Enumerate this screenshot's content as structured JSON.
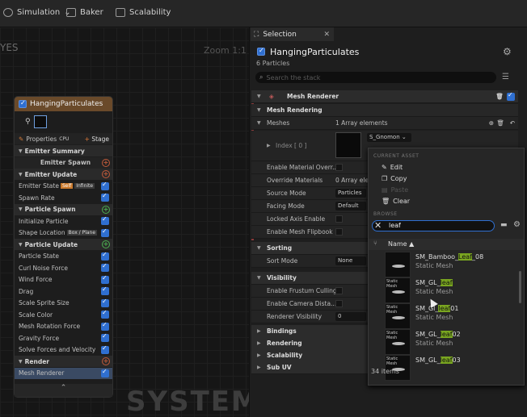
{
  "toolbar": {
    "simulation": "Simulation",
    "baker": "Baker",
    "scalability": "Scalability"
  },
  "graph": {
    "tab_fragment": "YES",
    "zoom": "Zoom 1:1",
    "watermark": "SYSTEM"
  },
  "node": {
    "title": "HangingParticulates",
    "properties": "Properties",
    "stage": "Stage",
    "rows": [
      {
        "label": "Emitter Summary",
        "type": "sec"
      },
      {
        "label": "Emitter Spawn",
        "type": "sub",
        "plus": "red"
      },
      {
        "label": "Emitter Update",
        "type": "sec",
        "plus": "red"
      },
      {
        "label": "Emitter State",
        "badges": [
          "Self",
          "Infinite"
        ],
        "check": true
      },
      {
        "label": "Spawn Rate",
        "check": true
      },
      {
        "label": "Particle Spawn",
        "type": "sec",
        "plus": "green"
      },
      {
        "label": "Initialize Particle",
        "check": true
      },
      {
        "label": "Shape Location",
        "badges2": [
          "Box / Plane"
        ],
        "check": true
      },
      {
        "label": "Particle Update",
        "type": "sec",
        "plus": "green"
      },
      {
        "label": "Particle State",
        "check": true
      },
      {
        "label": "Curl Noise Force",
        "check": true
      },
      {
        "label": "Wind Force",
        "check": true
      },
      {
        "label": "Drag",
        "check": true
      },
      {
        "label": "Scale Sprite Size",
        "check": true
      },
      {
        "label": "Scale Color",
        "check": true
      },
      {
        "label": "Mesh Rotation Force",
        "check": true
      },
      {
        "label": "Gravity Force",
        "check": true
      },
      {
        "label": "Solve Forces and Velocity",
        "check": true
      },
      {
        "label": "Render",
        "type": "sec",
        "plus": "red"
      },
      {
        "label": "Mesh Renderer",
        "check": true,
        "selected": true
      }
    ]
  },
  "selection": {
    "tab": "Selection",
    "emitter": "HangingParticulates",
    "particles": "6 Particles",
    "search_placeholder": "Search the stack",
    "rows": {
      "mesh_renderer": "Mesh Renderer",
      "mesh_rendering": "Mesh Rendering",
      "meshes": "Meshes",
      "meshes_val": "1 Array elements",
      "index": "Index [ 0 ]",
      "mesh_dropdown": "S_Gnomon",
      "enable_mat": "Enable Material Overr...",
      "override_mat": "Override Materials",
      "override_val": "0 Array ele",
      "source_mode": "Source Mode",
      "source_val": "Particles",
      "facing_mode": "Facing Mode",
      "facing_val": "Default",
      "locked_axis": "Locked Axis Enable",
      "flipbook": "Enable Mesh Flipbook",
      "sorting": "Sorting",
      "sort_mode": "Sort Mode",
      "sort_val": "None",
      "visibility": "Visibility",
      "frustum": "Enable Frustum Culling",
      "camera_dist": "Enable Camera Dista...",
      "renderer_vis": "Renderer Visibility",
      "renderer_vis_val": "0",
      "bindings": "Bindings",
      "rendering": "Rendering",
      "scalability": "Scalability",
      "subuv": "Sub UV"
    }
  },
  "popup": {
    "current_asset": "CURRENT ASSET",
    "edit": "Edit",
    "copy": "Copy",
    "paste": "Paste",
    "clear": "Clear",
    "browse": "BROWSE",
    "search_value": "leaf",
    "name_header": "Name ▲",
    "assets": [
      {
        "pre": "SM_Bamboo_",
        "hl": "Leaf",
        "post": "_08",
        "type": "Static Mesh",
        "tag": ""
      },
      {
        "pre": "SM_GL_",
        "hl": "leaf",
        "post": "",
        "type": "Static Mesh",
        "tag": "Static Mesh"
      },
      {
        "pre": "SM_Gl_",
        "hl": "leaf",
        "post": "01",
        "type": "Static Mesh",
        "tag": "Static Mesh"
      },
      {
        "pre": "SM_GL_",
        "hl": "leaf",
        "post": "02",
        "type": "Static Mesh",
        "tag": "Static Mesh"
      },
      {
        "pre": "SM_GL_",
        "hl": "leaf",
        "post": "03",
        "type": "",
        "tag": "Static Mesh"
      }
    ],
    "count": "34 items"
  }
}
